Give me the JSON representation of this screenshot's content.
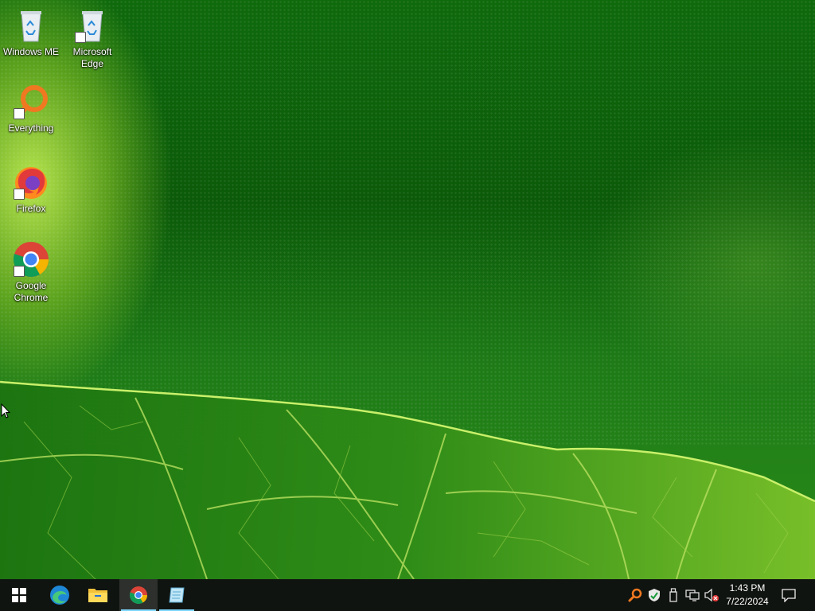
{
  "desktop": {
    "icons": [
      {
        "label": "Windows ME",
        "icon": "recycle-bin-icon"
      },
      {
        "label": "Microsoft Edge",
        "icon": "recycle-bin-icon"
      },
      {
        "label": "Everything",
        "icon": "everything-search-icon"
      },
      {
        "label": "Firefox",
        "icon": "firefox-icon"
      },
      {
        "label": "Google Chrome",
        "icon": "chrome-icon"
      }
    ]
  },
  "taskbar": {
    "start": {
      "icon": "windows-logo-icon"
    },
    "pinned": [
      {
        "name": "Microsoft Edge",
        "icon": "edge-icon"
      },
      {
        "name": "File Explorer",
        "icon": "folder-icon"
      },
      {
        "name": "Google Chrome",
        "icon": "chrome-icon",
        "active": true
      },
      {
        "name": "Notepad",
        "icon": "notepad-icon"
      }
    ],
    "tray": [
      {
        "name": "Everything",
        "icon": "everything-search-icon"
      },
      {
        "name": "Windows Security",
        "icon": "shield-icon"
      },
      {
        "name": "USB device",
        "icon": "usb-icon"
      },
      {
        "name": "Network",
        "icon": "network-icon"
      },
      {
        "name": "Volume muted",
        "icon": "speaker-muted-icon"
      }
    ],
    "clock": {
      "time": "1:43 PM",
      "date": "7/22/2024"
    },
    "notifications": {
      "icon": "action-center-icon"
    }
  },
  "colors": {
    "taskbar_bg": "#101410",
    "active_indicator": "#7fd7ff",
    "wallpaper_green": "#0f6a0c"
  }
}
